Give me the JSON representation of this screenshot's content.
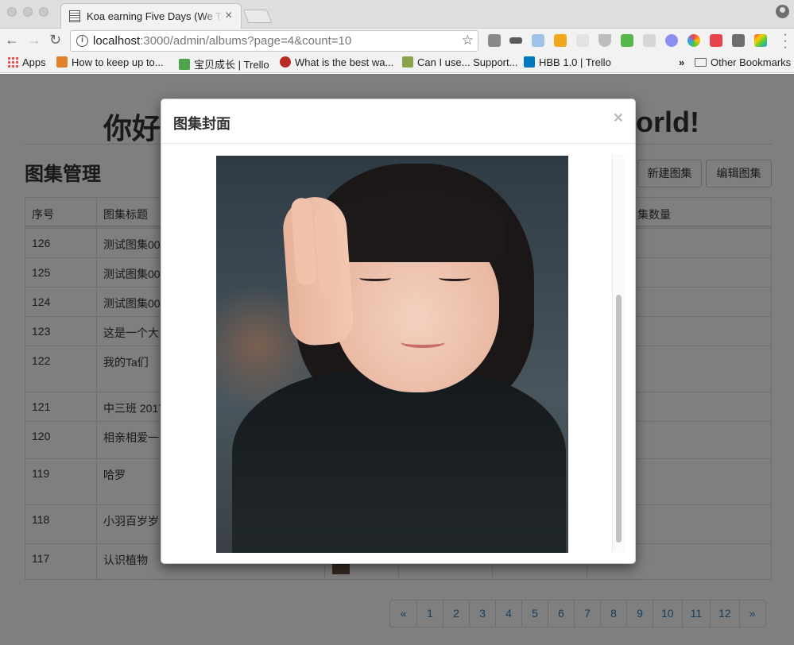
{
  "browser": {
    "tab_title": "Koa earning Five Days (We The",
    "tab_close": "×",
    "url_host": "localhost",
    "url_rest": ":3000/admin/albums?page=4&count=10",
    "info_glyph": "i",
    "star": "☆",
    "back": "←",
    "forward": "→",
    "reload": "↻"
  },
  "bookmarks": {
    "apps": "Apps",
    "items": [
      "How to keep up to...",
      "宝贝成长 | Trello",
      "What is the best wa...",
      "Can I use... Support...",
      "HBB 1.0 | Trello"
    ],
    "overflow": "»",
    "other": "Other Bookmarks"
  },
  "page": {
    "hero_left": "你好",
    "hero_right": "orld!",
    "section_title": "图集管理",
    "buttons": {
      "new_album": "新建图集",
      "edit_album": "编辑图集"
    },
    "table": {
      "headers": {
        "index": "序号",
        "title": "图集标题",
        "count": "集数量"
      },
      "rows": [
        {
          "index": "126",
          "title": "测试图集00"
        },
        {
          "index": "125",
          "title": "测试图集00"
        },
        {
          "index": "124",
          "title": "测试图集00"
        },
        {
          "index": "123",
          "title": "这是一个大"
        },
        {
          "index": "122",
          "title": "我的Ta们"
        },
        {
          "index": "121",
          "title": "中三班 2017"
        },
        {
          "index": "120",
          "title": "相亲相爱一"
        },
        {
          "index": "119",
          "title": "哈罗"
        },
        {
          "index": "118",
          "title": "小羽百岁岁"
        },
        {
          "index": "117",
          "title": "认识植物"
        }
      ]
    },
    "pagination": [
      "«",
      "1",
      "2",
      "3",
      "4",
      "5",
      "6",
      "7",
      "8",
      "9",
      "10",
      "11",
      "12",
      "»"
    ]
  },
  "modal": {
    "title": "图集封面",
    "close": "×"
  }
}
